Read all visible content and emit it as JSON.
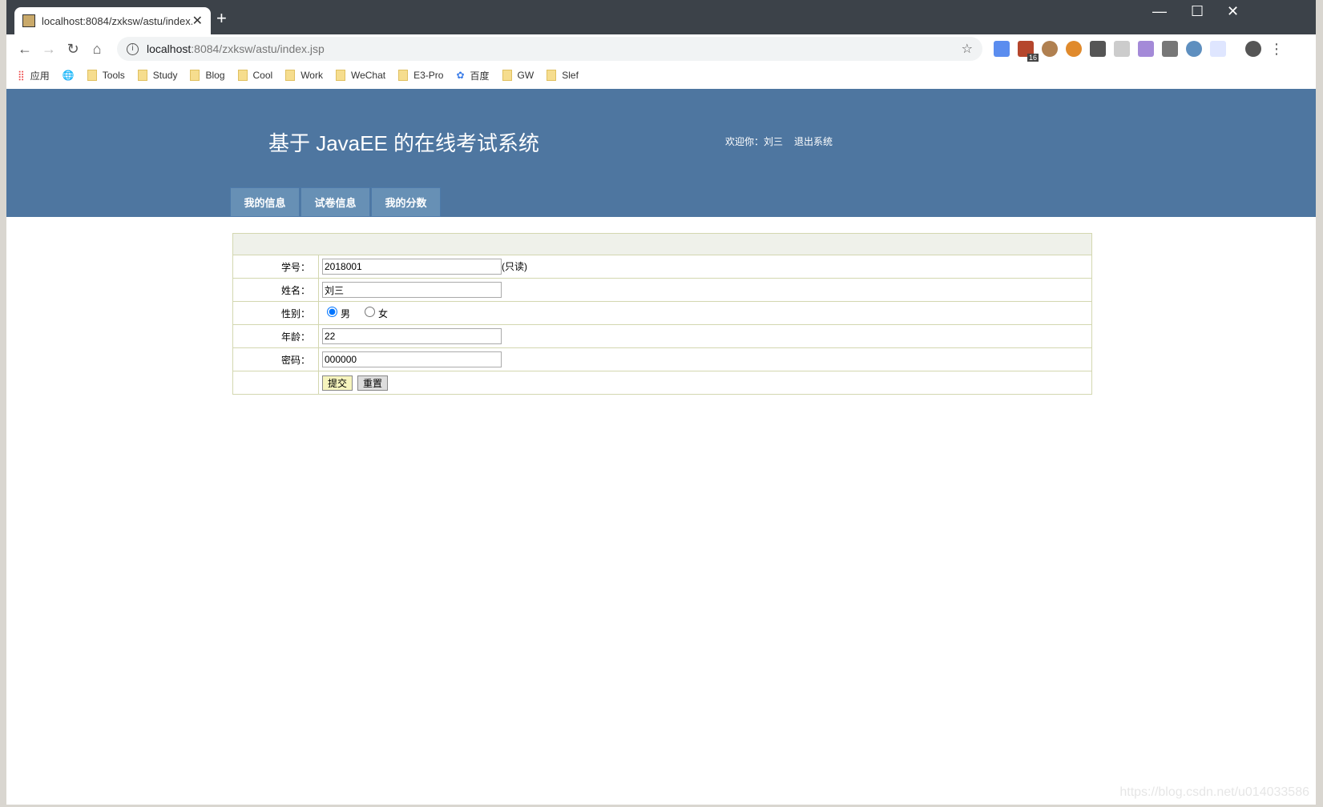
{
  "browser": {
    "tab_title": "localhost:8084/zxksw/astu/index.jsp",
    "url_host": "localhost",
    "url_path": ":8084/zxksw/astu/index.jsp",
    "ext_badge": "16",
    "bookmarks": [
      "应用",
      "Tools",
      "Study",
      "Blog",
      "Cool",
      "Work",
      "WeChat",
      "E3-Pro",
      "百度",
      "GW",
      "Slef"
    ]
  },
  "header": {
    "title": "基于 JavaEE 的在线考试系统",
    "welcome": "欢迎你：刘三",
    "logout": "退出系统"
  },
  "menu": [
    "我的信息",
    "试卷信息",
    "我的分数"
  ],
  "form": {
    "id_label": "学号：",
    "id_value": "2018001",
    "id_note": "(只读)",
    "name_label": "姓名：",
    "name_value": "刘三",
    "gender_label": "性别：",
    "gender_male": "男",
    "gender_female": "女",
    "gender_selected": "男",
    "age_label": "年龄：",
    "age_value": "22",
    "pwd_label": "密码：",
    "pwd_value": "000000",
    "submit": "提交",
    "reset": "重置"
  },
  "watermark": "https://blog.csdn.net/u014033586",
  "colors": {
    "header": "#4e76a0",
    "menu_tab": "#6790b5",
    "table_border": "#d3d7b0"
  }
}
